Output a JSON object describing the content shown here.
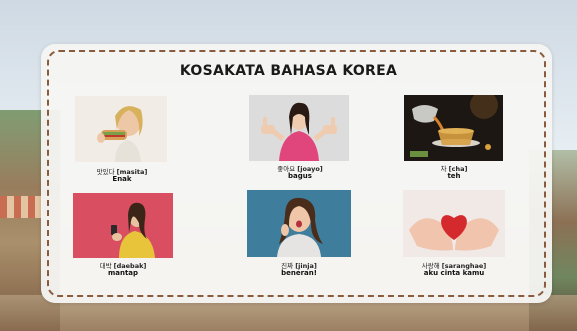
{
  "title": "KOSAKATA BAHASA KOREA",
  "cards": [
    {
      "hangul": "맛있다",
      "romanization": "[masita]",
      "meaning": "Enak",
      "image": "woman-eating-sandwich"
    },
    {
      "hangul": "좋아요",
      "romanization": "[joayo]",
      "meaning": "bagus",
      "image": "woman-thumbs-up"
    },
    {
      "hangul": "차",
      "romanization": "[cha]",
      "meaning": "teh",
      "image": "tea-pouring"
    },
    {
      "hangul": "대박",
      "romanization": "[daebak]",
      "meaning": "mantap",
      "image": "woman-with-phone"
    },
    {
      "hangul": "진짜",
      "romanization": "[jinja]",
      "meaning": "beneran!",
      "image": "surprised-woman"
    },
    {
      "hangul": "사랑해",
      "romanization": "[saranghae]",
      "meaning": "aku cinta kamu",
      "image": "hands-holding-heart"
    }
  ],
  "colors": {
    "border": "#8a5a3c",
    "panel": "#f6f5f3",
    "title": "#1a1a1a"
  }
}
